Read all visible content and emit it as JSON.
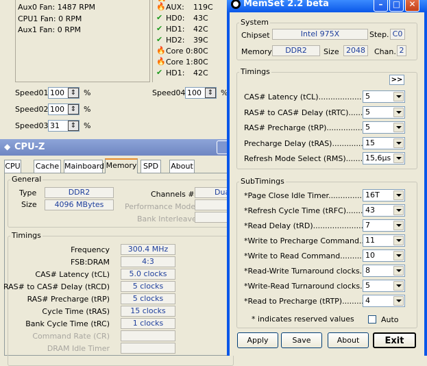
{
  "fan_window": {
    "fans": [
      "Aux0 Fan:  1487 RPM",
      "CPU1 Fan:  0 RPM",
      "Aux1 Fan:  0 RPM"
    ],
    "temps": [
      {
        "icon": "fire",
        "label": "AUX:",
        "value": "119C"
      },
      {
        "icon": "check",
        "label": "HD0:",
        "value": "43C"
      },
      {
        "icon": "check",
        "label": "HD1:",
        "value": "42C"
      },
      {
        "icon": "check",
        "label": "HD2:",
        "value": "39C"
      },
      {
        "icon": "fire",
        "label": "Core 0:",
        "value": "80C"
      },
      {
        "icon": "fire",
        "label": "Core 1:",
        "value": "80C"
      },
      {
        "icon": "check",
        "label": "HD1:",
        "value": "42C"
      }
    ],
    "speeds": [
      {
        "label": "Speed01:",
        "value": "100",
        "unit": "%"
      },
      {
        "label": "Speed02:",
        "value": "100",
        "unit": "%"
      },
      {
        "label": "Speed03:",
        "value": "31",
        "unit": "%"
      },
      {
        "label": "Speed04:",
        "value": "100",
        "unit": "%"
      }
    ]
  },
  "cpuz": {
    "title": "CPU-Z",
    "tabs": [
      "CPU",
      "Cache",
      "Mainboard",
      "Memory",
      "SPD",
      "About"
    ],
    "active_tab": "Memory",
    "general": {
      "group": "General",
      "type_label": "Type",
      "type_value": "DDR2",
      "size_label": "Size",
      "size_value": "4096 MBytes",
      "channels_label": "Channels #",
      "channels_value": "Dual",
      "perf_label": "Performance Mode",
      "bank_label": "Bank Interleave"
    },
    "timings": {
      "group": "Timings",
      "rows": [
        {
          "label": "Frequency",
          "value": "300.4 MHz",
          "enabled": true
        },
        {
          "label": "FSB:DRAM",
          "value": "4:3",
          "enabled": true
        },
        {
          "label": "CAS# Latency (tCL)",
          "value": "5.0 clocks",
          "enabled": true
        },
        {
          "label": "RAS# to CAS# Delay (tRCD)",
          "value": "5 clocks",
          "enabled": true
        },
        {
          "label": "RAS# Precharge (tRP)",
          "value": "5 clocks",
          "enabled": true
        },
        {
          "label": "Cycle Time (tRAS)",
          "value": "15 clocks",
          "enabled": true
        },
        {
          "label": "Bank Cycle Time (tRC)",
          "value": "1 clocks",
          "enabled": true
        },
        {
          "label": "Command Rate (CR)",
          "value": "",
          "enabled": false
        },
        {
          "label": "DRAM Idle Timer",
          "value": "",
          "enabled": false
        }
      ]
    }
  },
  "memset": {
    "title": "MemSet 2.2 beta",
    "system": {
      "group": "System",
      "chipset_label": "Chipset",
      "chipset_value": "Intel 975X",
      "step_label": "Step.",
      "step_value": "C0",
      "memory_label": "Memory",
      "memory_value": "DDR2",
      "size_label": "Size",
      "size_value": "2048",
      "chan_label": "Chan.",
      "chan_value": "2"
    },
    "timings": {
      "group": "Timings",
      "more_button": ">>",
      "rows": [
        {
          "label": "CAS# Latency (tCL)..................",
          "value": "5"
        },
        {
          "label": "RAS# to CAS# Delay (tRTC)..........",
          "value": "5"
        },
        {
          "label": "RAS# Precharge (tRP)....................",
          "value": "5"
        },
        {
          "label": "Precharge Delay  (tRAS)....................",
          "value": "15"
        },
        {
          "label": "Refresh Mode Select (RMS)..........",
          "value": "15,6µs"
        }
      ]
    },
    "subtimings": {
      "group": "SubTimings",
      "rows": [
        {
          "label": "*Page Close Idle Timer........................",
          "value": "16T"
        },
        {
          "label": "*Refresh Cycle Time (tRFC)..............",
          "value": "43"
        },
        {
          "label": "*Read Delay (tRD)...............................",
          "value": "7"
        },
        {
          "label": "*Write to Precharge Command.........",
          "value": "11"
        },
        {
          "label": "*Write to Read Command..................",
          "value": "10"
        },
        {
          "label": "*Read-Write Turnaround clocks.........",
          "value": "8"
        },
        {
          "label": "*Write-Read Turnaround clocks.........",
          "value": "5"
        },
        {
          "label": "*Read to Precharge (tRTP)................",
          "value": "4"
        }
      ],
      "note": "* indicates reserved values",
      "auto_label": "Auto"
    },
    "buttons": {
      "apply": "Apply",
      "save": "Save",
      "about": "About",
      "exit": "Exit"
    }
  },
  "colors": {
    "xp_blue": "#0a57e8",
    "value_blue": "#1c3d9c",
    "face": "#ece9d8"
  }
}
